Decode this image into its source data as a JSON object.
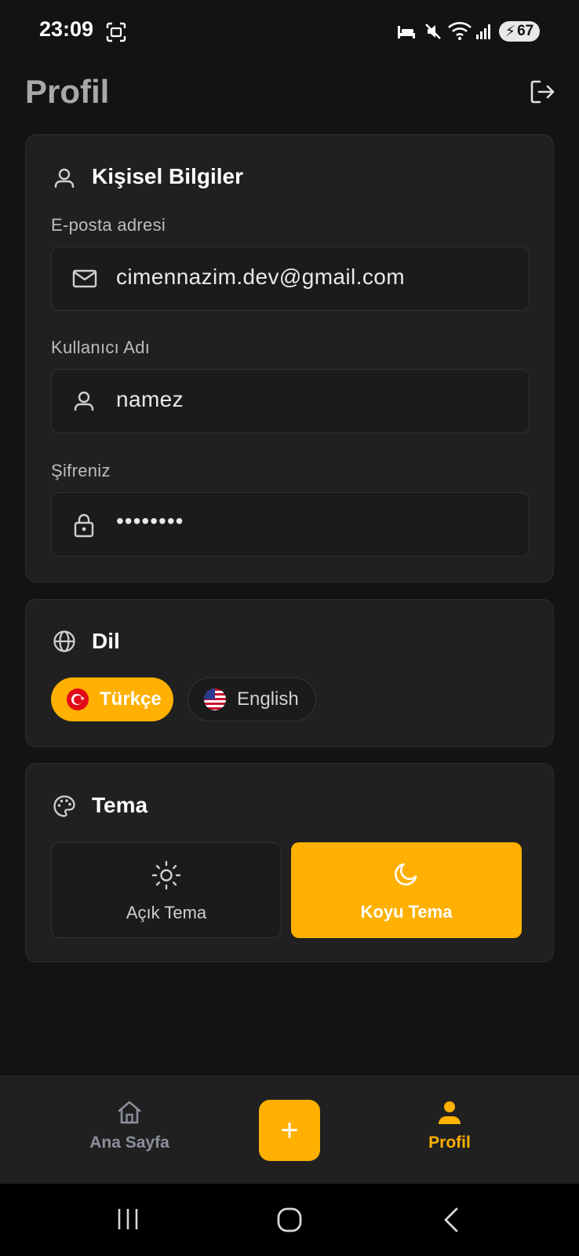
{
  "status_bar": {
    "time": "23:09",
    "battery": "67",
    "icons": [
      "screenshot-icon",
      "sleep-icon",
      "mute-icon",
      "wifi-icon",
      "signal-icon",
      "battery-charging-icon"
    ]
  },
  "header": {
    "title": "Profil",
    "logout_icon": "logout-icon"
  },
  "personal": {
    "title": "Kişisel Bilgiler",
    "email_label": "E-posta adresi",
    "email_value": "cimennazim.dev@gmail.com",
    "username_label": "Kullanıcı Adı",
    "username_value": "namez",
    "password_label": "Şifreniz",
    "password_value": "••••••••"
  },
  "language": {
    "title": "Dil",
    "options": [
      {
        "label": "Türkçe",
        "selected": true
      },
      {
        "label": "English",
        "selected": false
      }
    ]
  },
  "theme": {
    "title": "Tema",
    "options": [
      {
        "label": "Açık Tema",
        "selected": false
      },
      {
        "label": "Koyu Tema",
        "selected": true
      }
    ]
  },
  "bottom_nav": {
    "home_label": "Ana Sayfa",
    "add_label": "+",
    "profile_label": "Profil"
  },
  "colors": {
    "accent": "#ffb000",
    "background": "#131313",
    "card": "#202020"
  }
}
